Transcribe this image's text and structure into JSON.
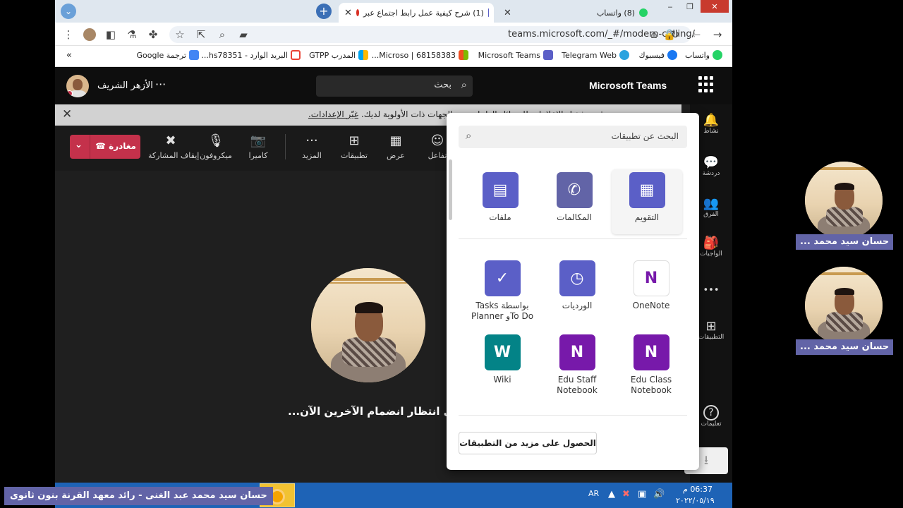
{
  "browser": {
    "tabs": [
      {
        "title": "(1) شرح كيفية عمل رابط اجتماع عبر",
        "active": true
      },
      {
        "title": "(8) واتساب",
        "active": false
      }
    ],
    "window_controls": {
      "minimize": "‒",
      "maximize": "❐",
      "close": "✕"
    },
    "url": "teams.microsoft.com/_#/modern-calling/",
    "bookmarks": [
      {
        "label": "واتساب",
        "color": "#25d366"
      },
      {
        "label": "فيسبوك",
        "color": "#1877f2"
      },
      {
        "label": "Telegram Web",
        "color": "#2aa3df"
      },
      {
        "label": "Microsoft Teams",
        "color": "#5b5fc7"
      },
      {
        "label": "68158383 | Microso...",
        "color": "#f25022"
      },
      {
        "label": "المدرب GTPP",
        "color": "#f25022"
      },
      {
        "label": "البريد الوارد - hs78351...",
        "color": "#ea4335"
      },
      {
        "label": "ترجمة Google",
        "color": "#4285f4"
      }
    ],
    "bookmarks_overflow": "»"
  },
  "teams": {
    "app_title": "Microsoft Teams",
    "search_label": "بحث",
    "org_name": "الأزهر الشريف",
    "org_more": "···",
    "notice": {
      "text": "قم بتشغيل الإعلامات للرسائل العاجلة ومن الجهات ذات الأولوية لديك.",
      "link": "غيّر الإعدادات."
    },
    "toolbar": {
      "leave": "مغادرة",
      "leave_chevron": "⌄",
      "controls": [
        {
          "label": "إيقاف المشاركة",
          "glyph": "✖"
        },
        {
          "label": "ميكروفون",
          "glyph": "🎙"
        },
        {
          "label": "كاميرا",
          "glyph": "📷"
        },
        {
          "label": "المزيد",
          "glyph": "···"
        },
        {
          "label": "تطبيقات",
          "glyph": "⊞"
        },
        {
          "label": "عرض",
          "glyph": "▦"
        },
        {
          "label": "تفاعل",
          "glyph": "☺"
        }
      ]
    },
    "waiting_text": "في انتظار انضمام الآخرين الآن...",
    "rail": [
      {
        "label": "نشاط",
        "glyph": "🔔"
      },
      {
        "label": "دردشة",
        "glyph": "💬"
      },
      {
        "label": "الفرق",
        "glyph": "👥"
      },
      {
        "label": "الواجبات",
        "glyph": "🎒"
      },
      {
        "label": "",
        "glyph": "•••"
      },
      {
        "label": "التطبيقات",
        "glyph": "⊞"
      },
      {
        "label": "تعليمات",
        "glyph": "?"
      }
    ],
    "apps_flyout": {
      "search_placeholder": "البحث عن تطبيقات",
      "pinned": [
        {
          "name": "التقويم",
          "color": "#5b5fc7",
          "glyph": "▦"
        },
        {
          "name": "المكالمات",
          "color": "#6264a7",
          "glyph": "✆"
        },
        {
          "name": "ملفات",
          "color": "#5b5fc7",
          "glyph": "▤"
        }
      ],
      "apps": [
        {
          "name": "OneNote",
          "color": "#7719aa",
          "glyph": "N"
        },
        {
          "name": "الورديات",
          "color": "#5b5fc7",
          "glyph": "◷"
        },
        {
          "name": "Tasks بواسطة Planner وTo Do",
          "color": "#5b5fc7",
          "glyph": "✓"
        },
        {
          "name": "Edu Class Notebook",
          "color": "#7719aa",
          "glyph": "N"
        },
        {
          "name": "Edu Staff Notebook",
          "color": "#7719aa",
          "glyph": "N"
        },
        {
          "name": "Wiki",
          "color": "#038387",
          "glyph": "W"
        }
      ],
      "more_apps": "الحصول على مزيد من التطبيقات",
      "download_glyph": "⭳"
    }
  },
  "participants": [
    {
      "name": "حسان سيد محمد ..."
    },
    {
      "name": "حسان سيد محمد ..."
    }
  ],
  "taskbar": {
    "lang": "AR",
    "time": "06:37 م",
    "date": "٢٠٢٢/٠٥/١٩"
  },
  "caption": "حسان سيد محمد عبد الغنى - رائد معهد القرنة بنون ثانوى"
}
